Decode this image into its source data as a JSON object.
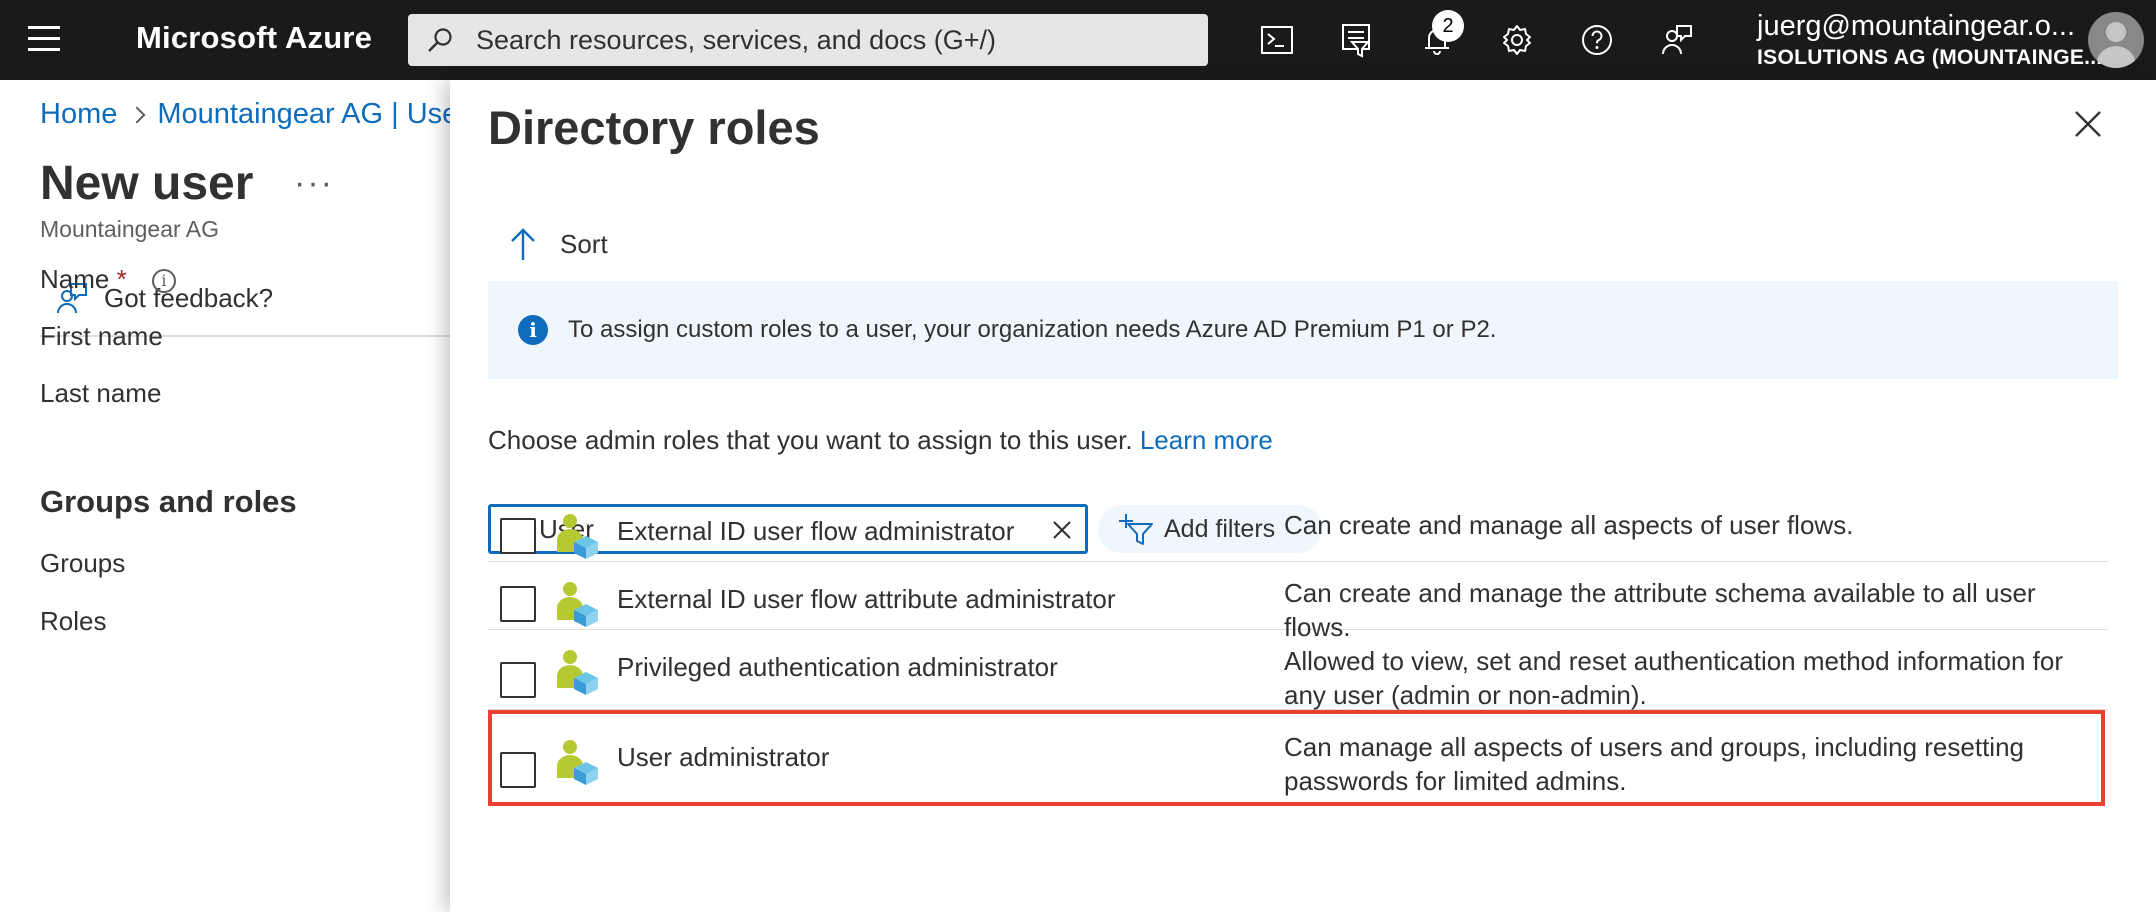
{
  "topbar": {
    "brand": "Microsoft Azure",
    "search_placeholder": "Search resources, services, and docs (G+/)",
    "notification_count": "2",
    "account_email": "juerg@mountaingear.o...",
    "account_org": "ISOLUTIONS AG (MOUNTAINGE..."
  },
  "background": {
    "breadcrumb": [
      "Home",
      "Mountaingear AG | Use"
    ],
    "page_title": "New user",
    "ellipsis": "···",
    "subtitle": "Mountaingear AG",
    "feedback": "Got feedback?",
    "name_label": "Name",
    "required_mark": "*",
    "info_glyph": "i",
    "first_name": "First name",
    "last_name": "Last name",
    "groups_roles_heading": "Groups and roles",
    "groups": "Groups",
    "roles": "Roles"
  },
  "panel": {
    "title": "Directory roles",
    "sort": "Sort",
    "info_glyph": "i",
    "info_text": "To assign custom roles to a user, your organization needs Azure AD Premium P1 or P2.",
    "choose_text": "Choose admin roles that you want to assign to this user.",
    "learn_more": "Learn more",
    "search_value": "User",
    "add_filters": "Add filters",
    "roles": [
      {
        "name": "External ID user flow administrator",
        "description": "Can create and manage all aspects of user flows.",
        "checked": false
      },
      {
        "name": "External ID user flow attribute administrator",
        "description": "Can create and manage the attribute schema available to all user flows.",
        "checked": false
      },
      {
        "name": "Privileged authentication administrator",
        "description": "Allowed to view, set and reset authentication method information for any user (admin or non-admin).",
        "checked": false
      },
      {
        "name": "User administrator",
        "description": "Can manage all aspects of users and groups, including resetting passwords for limited admins.",
        "checked": false
      }
    ]
  },
  "colors": {
    "topbar_bg": "#1b1a19",
    "link": "#0f6cbd",
    "info_bg": "#eff6fc",
    "highlight": "#e8412f"
  }
}
